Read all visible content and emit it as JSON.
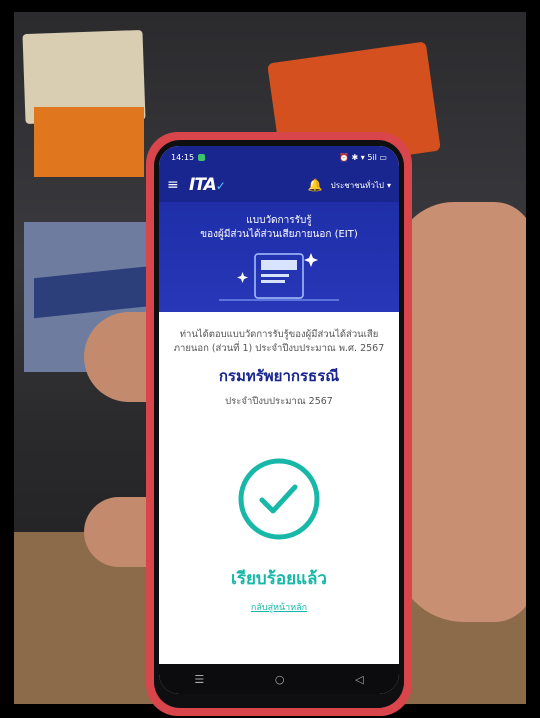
{
  "status_bar": {
    "time": "14:15",
    "indicators": "⏰ ✱ ▾ 5il ▭"
  },
  "app_bar": {
    "logo": "ITA",
    "user_role": "ประชาชนทั่วไป"
  },
  "hero": {
    "title_line1": "แบบวัดการรับรู้",
    "title_line2": "ของผู้มีส่วนได้ส่วนเสียภายนอก (EIT)"
  },
  "result": {
    "notice": "ท่านได้ตอบแบบวัดการรับรู้ของผู้มีส่วนได้ส่วนเสียภายนอก (ส่วนที่ 1) ประจำปีงบประมาณ พ.ศ. 2567",
    "organization": "กรมทรัพยากรธรณี",
    "fiscal_year": "ประจำปีงบประมาณ 2567",
    "status": "เรียบร้อยแล้ว",
    "back_link": "กลับสู่หน้าหลัก"
  },
  "nav": {
    "recent": "☰",
    "home": "○",
    "back": "◁"
  },
  "colors": {
    "primary": "#1a2690",
    "success": "#17b8a8",
    "phone_case": "#d8454b"
  },
  "icons": [
    "menu-icon",
    "bell-icon",
    "chevron-down-icon",
    "folder-icon",
    "checkmark-circle-icon"
  ]
}
